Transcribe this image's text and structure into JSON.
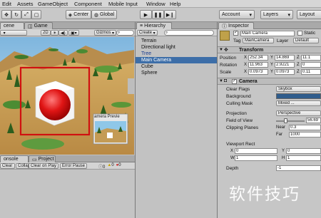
{
  "menubar": {
    "items": [
      "Edit",
      "Assets",
      "GameObject",
      "Component",
      "Mobile Input",
      "Window",
      "Help"
    ]
  },
  "toolbar": {
    "center_label": "Center",
    "global_label": "Global",
    "account_label": "Account",
    "layers_label": "Layers",
    "layout_label": "Layout"
  },
  "scene_panel": {
    "tabs": [
      "cene",
      "Game"
    ],
    "mode_label": "2D",
    "gizmos_label": "Gizmos",
    "search_placeholder": "All",
    "camera_preview_title": "amera Previe"
  },
  "hierarchy": {
    "tab_label": "Hierarchy",
    "create_label": "Create",
    "search_placeholder": "All",
    "items": [
      "Terrain",
      "Directional light",
      "Tree",
      "Main Camera",
      "Cube",
      "Sphere"
    ],
    "selected_index": 3
  },
  "inspector": {
    "tab_label": "Inspector",
    "object_name": "Main Camera",
    "static_label": "Static",
    "tag_label": "Tag",
    "tag_value": "MainCamera",
    "layer_label": "Layer",
    "layer_value": "Default",
    "transform": {
      "title": "Transform",
      "position_label": "Position",
      "rotation_label": "Rotation",
      "scale_label": "Scale",
      "position": [
        "252.34",
        "14.869",
        "11.1"
      ],
      "rotation": [
        "11.963",
        "2.9221",
        "0"
      ],
      "scale": [
        "0.0973",
        "0.0973",
        "0.11"
      ]
    },
    "camera": {
      "title": "Camera",
      "clear_flags_label": "Clear Flags",
      "clear_flags_value": "Skybox",
      "background_label": "Background",
      "background_color": "#2f5c8c",
      "culling_mask_label": "Culling Mask",
      "culling_mask_value": "Mixed ...",
      "projection_label": "Projection",
      "projection_value": "Perspective",
      "fov_label": "Field of View",
      "fov_value": "56.69",
      "clipping_label": "Clipping Planes",
      "near_label": "Near",
      "near_value": "0.3",
      "far_label": "Far",
      "far_value": "1000",
      "viewport_label": "Viewport Rect",
      "vx": "0",
      "vy": "0",
      "vw": "1",
      "vh": "1",
      "depth_label": "Depth",
      "depth_value": "-1"
    }
  },
  "bottom_panel": {
    "tabs": [
      "onsole",
      "Project"
    ],
    "buttons": [
      "Clear",
      "Collapse",
      "Clear on Play",
      "Error Pause"
    ],
    "counts": [
      "0",
      "0",
      "0"
    ]
  },
  "watermark_text": "软件技巧",
  "colors": {
    "selection": "#3d6ea8",
    "highlight_box": "#d01010",
    "sky": "#8dc4e6",
    "sand": "#c9a05a"
  }
}
